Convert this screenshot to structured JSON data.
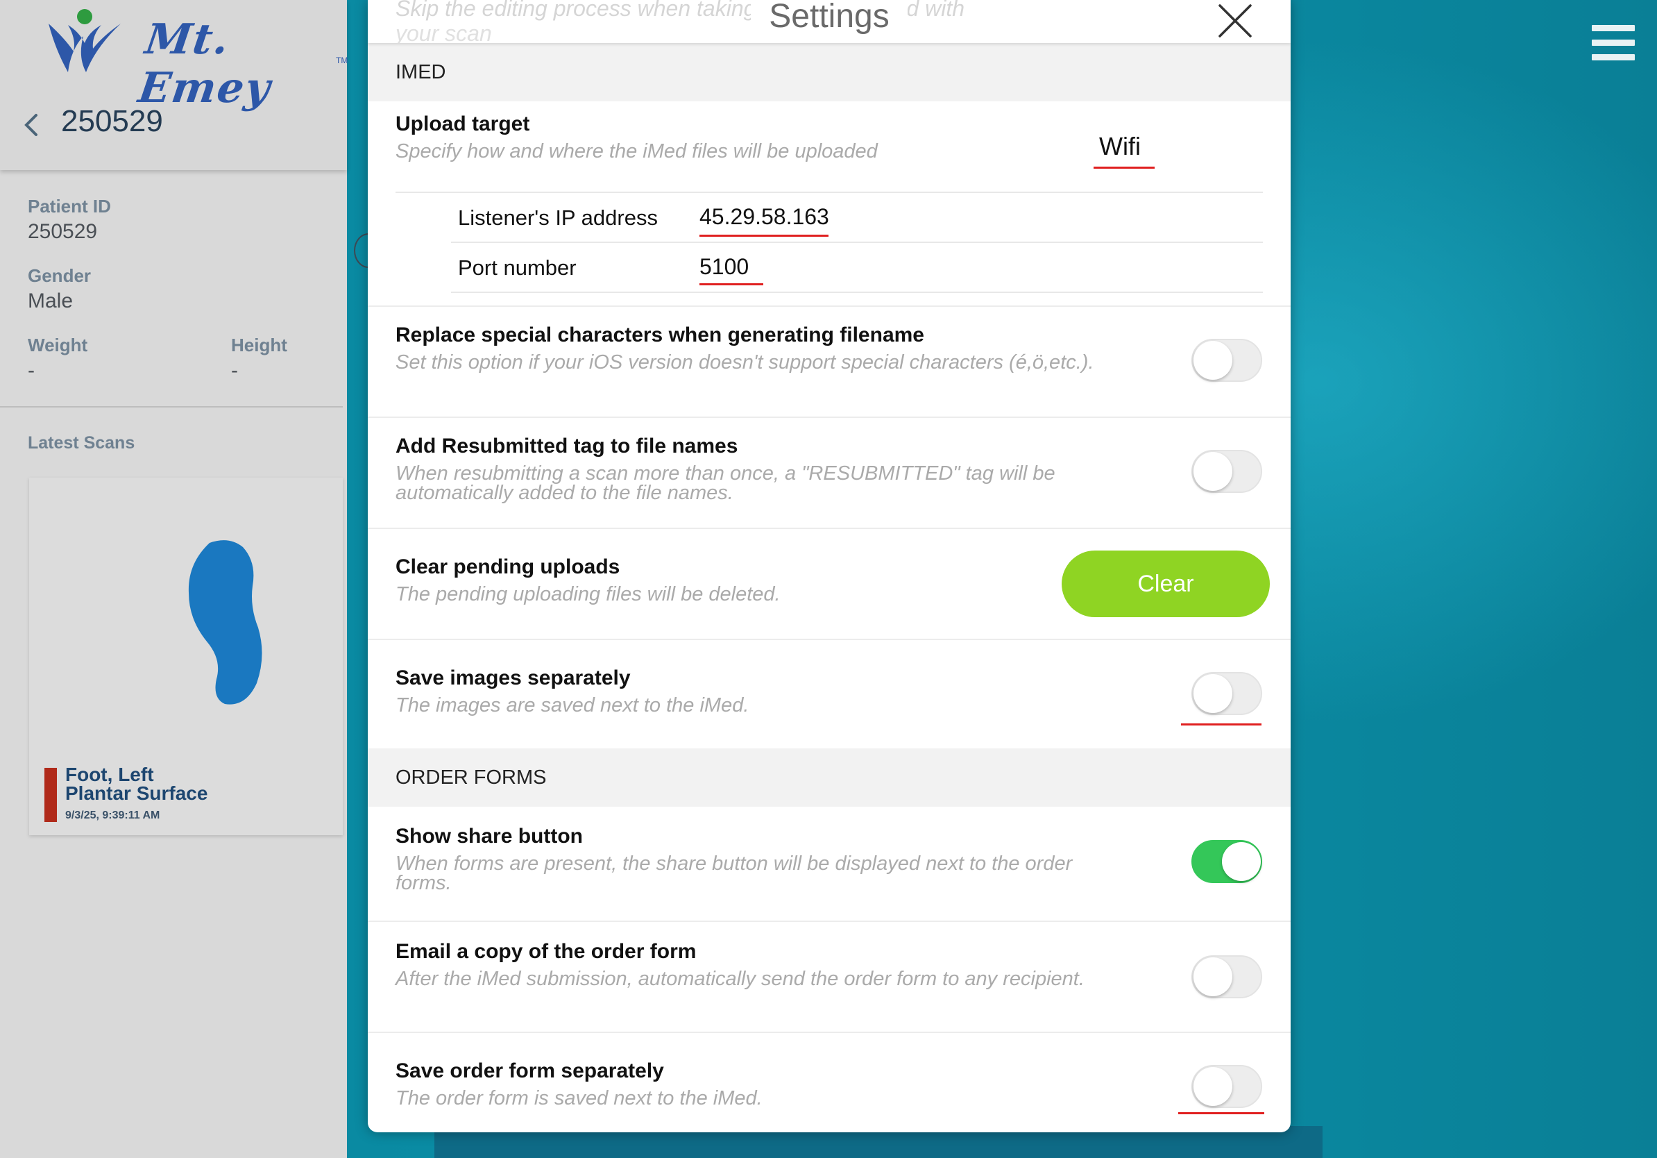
{
  "brand": {
    "logo_text": "Mt. Emey",
    "tm": "TM"
  },
  "patient": {
    "header_id": "250529",
    "fields": [
      {
        "label": "Patient ID",
        "value": "250529"
      },
      {
        "label": "Gender",
        "value": "Male"
      },
      {
        "label": "Weight",
        "value": "-"
      },
      {
        "label": "Height",
        "value": "-"
      }
    ],
    "latest_scans_label": "Latest Scans",
    "scan": {
      "title_line1": "Foot, Left",
      "title_line2": "Plantar Surface",
      "date": "9/3/25, 9:39:11 AM"
    }
  },
  "modal": {
    "title": "Settings",
    "ghost_line1": "Skip the editing process when taking pictures to send with",
    "ghost_line2": "your scan",
    "sections": {
      "imed": "IMED",
      "order_forms": "ORDER FORMS"
    },
    "upload_target": {
      "title": "Upload target",
      "desc": "Specify how and where the iMed files will be uploaded",
      "value": "Wifi",
      "ip_label": "Listener's IP address",
      "ip_value": "45.29.58.163",
      "port_label": "Port number",
      "port_value": "5100"
    },
    "replace_special": {
      "title": "Replace special characters when generating filename",
      "desc": "Set this option if your iOS version doesn't support special characters (é,ö,etc.).",
      "on": false
    },
    "resubmitted_tag": {
      "title": "Add Resubmitted tag to file names",
      "desc": "When resubmitting a scan more than once, a \"RESUBMITTED\" tag will be automatically added to the file names.",
      "on": false
    },
    "clear_pending": {
      "title": "Clear pending uploads",
      "desc": "The pending uploading files will be deleted.",
      "button": "Clear"
    },
    "save_images": {
      "title": "Save images separately",
      "desc": "The images are saved next to the iMed.",
      "on": false
    },
    "show_share": {
      "title": "Show share button",
      "desc": "When forms are present, the share button will be displayed next to the order forms.",
      "on": true
    },
    "email_copy": {
      "title": "Email a copy of the order form",
      "desc": "After the iMed submission, automatically send the order form to any recipient.",
      "on": false
    },
    "save_order_form": {
      "title": "Save order form separately",
      "desc": "The order form is saved next to the iMed.",
      "on": false
    }
  },
  "colors": {
    "accent_green": "#8fd423",
    "toggle_on": "#34c759",
    "annotation_red": "#e02020",
    "brand_blue": "#2d57a8"
  },
  "icons": [
    "menu-icon",
    "close-icon",
    "back-chevron-icon",
    "logo-mark-icon"
  ]
}
